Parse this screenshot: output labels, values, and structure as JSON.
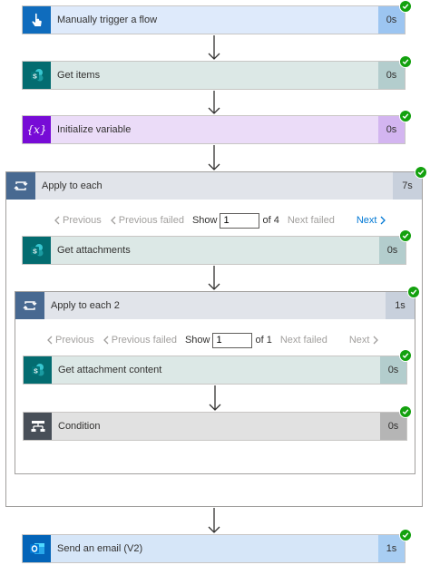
{
  "steps": {
    "trigger": {
      "title": "Manually trigger a flow",
      "duration": "0s",
      "icon": "hand-touch-icon"
    },
    "get_items": {
      "title": "Get items",
      "duration": "0s",
      "icon": "sharepoint-icon"
    },
    "init_var": {
      "title": "Initialize variable",
      "duration": "0s",
      "icon": "variable-icon"
    },
    "get_attachments": {
      "title": "Get attachments",
      "duration": "0s",
      "icon": "sharepoint-icon"
    },
    "get_attachment_content": {
      "title": "Get attachment content",
      "duration": "0s",
      "icon": "sharepoint-icon"
    },
    "condition": {
      "title": "Condition",
      "duration": "0s",
      "icon": "condition-icon"
    },
    "send_email": {
      "title": "Send an email (V2)",
      "duration": "1s",
      "icon": "outlook-icon"
    }
  },
  "loops": {
    "outer": {
      "title": "Apply to each",
      "duration": "7s",
      "pager": {
        "previous": "Previous",
        "previous_failed": "Previous failed",
        "show": "Show",
        "page": "1",
        "of": "of 4",
        "next_failed": "Next failed",
        "next": "Next"
      }
    },
    "inner": {
      "title": "Apply to each 2",
      "duration": "1s",
      "pager": {
        "previous": "Previous",
        "previous_failed": "Previous failed",
        "show": "Show",
        "page": "1",
        "of": "of 1",
        "next_failed": "Next failed",
        "next": "Next"
      }
    }
  },
  "colors": {
    "trigger": "#0f6cbd",
    "sharepoint": "#036c70",
    "variable": "#770bd6",
    "loop": "#486991",
    "condition": "#484f58",
    "outlook": "#0364b8",
    "success": "#13a10e"
  }
}
